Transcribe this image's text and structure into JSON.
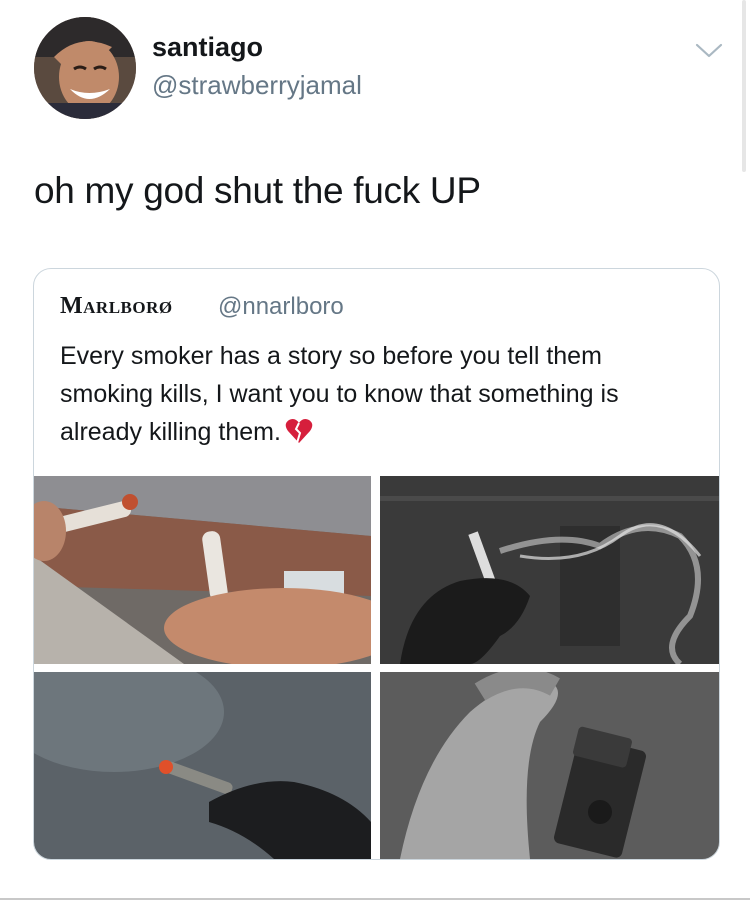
{
  "tweet": {
    "display_name": "santiago",
    "handle": "@strawberryjamal",
    "text": "oh my god shut the fuck UP"
  },
  "quoted_tweet": {
    "display_name": "Marlborø",
    "handle": "@nnarlboro",
    "text": "Every smoker has a story so before you tell them smoking kills, I want you to know that something is already killing them.",
    "emoji": "broken-heart-icon"
  },
  "icons": {
    "menu": "chevron-down-icon"
  },
  "colors": {
    "name": "#14171a",
    "handle": "#657786",
    "border": "#ccd6dd",
    "heart": "#d61f3c"
  }
}
